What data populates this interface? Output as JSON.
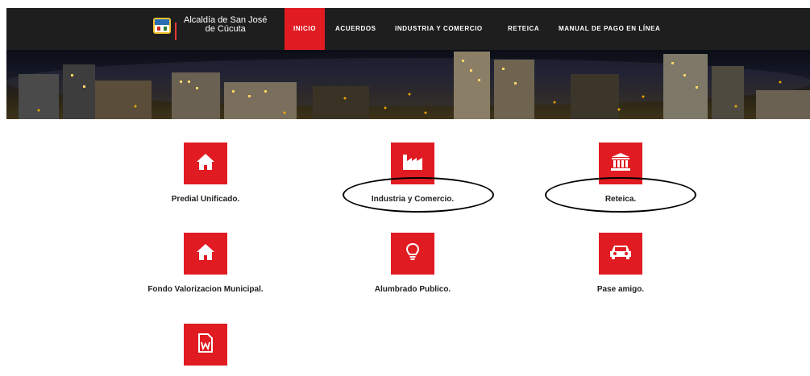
{
  "brand": {
    "line1": "Alcaldía de San José",
    "line2": "de Cúcuta",
    "crest_icon": "city-crest-icon"
  },
  "nav": {
    "items": [
      {
        "label": "INICIO",
        "active": true
      },
      {
        "label": "ACUERDOS",
        "active": false
      },
      {
        "label": "INDUSTRIA Y COMERCIO",
        "active": false
      },
      {
        "label": "RETEICA",
        "active": false
      },
      {
        "label": "MANUAL DE PAGO EN LÍNEA",
        "active": false
      }
    ]
  },
  "tiles": [
    {
      "label": "Predial Unificado.",
      "icon": "house-icon"
    },
    {
      "label": "Industria y Comercio.",
      "icon": "factory-icon"
    },
    {
      "label": "Reteica.",
      "icon": "bank-building-icon"
    },
    {
      "label": "Fondo Valorizacion Municipal.",
      "icon": "house-icon"
    },
    {
      "label": "Alumbrado Publico.",
      "icon": "lightbulb-icon"
    },
    {
      "label": "Pase amigo.",
      "icon": "car-icon"
    },
    {
      "label": "",
      "icon": "word-document-icon"
    }
  ],
  "colors": {
    "accent": "#e11b22",
    "navbar": "#1e1e1e"
  }
}
